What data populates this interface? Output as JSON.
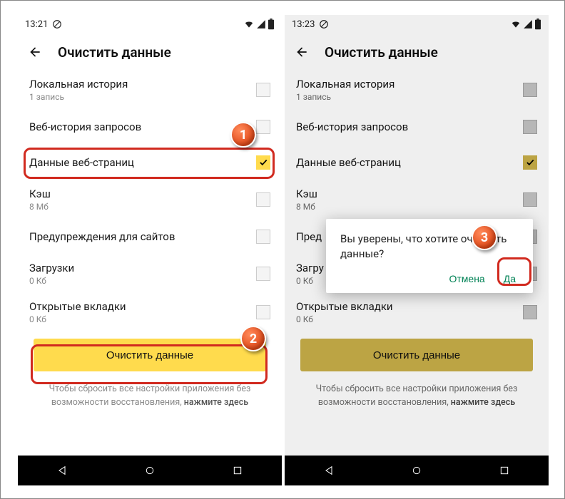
{
  "left": {
    "time": "13:21",
    "title": "Очистить данные",
    "items": [
      {
        "label": "Локальная история",
        "sub": "1 запись",
        "checked": false
      },
      {
        "label": "Веб-история запросов",
        "sub": "",
        "checked": false
      },
      {
        "label": "Данные веб-страниц",
        "sub": "",
        "checked": true
      },
      {
        "label": "Кэш",
        "sub": "8 Мб",
        "checked": false
      },
      {
        "label": "Предупреждения для сайтов",
        "sub": "",
        "checked": false
      },
      {
        "label": "Загрузки",
        "sub": "0 Кб",
        "checked": false
      },
      {
        "label": "Открытые вкладки",
        "sub": "0 Кб",
        "checked": false
      }
    ],
    "clear_btn": "Очистить данные",
    "footnote_a": "Чтобы сбросить все настройки приложения без возможности восстановления, ",
    "footnote_b": "нажмите здесь"
  },
  "right": {
    "time": "13:23",
    "title": "Очистить данные",
    "items": [
      {
        "label": "Локальная история",
        "sub": "1 запись",
        "checked": false
      },
      {
        "label": "Веб-история запросов",
        "sub": "",
        "checked": false
      },
      {
        "label": "Данные веб-страниц",
        "sub": "",
        "checked": true
      },
      {
        "label": "Кэш",
        "sub": "8 Мб",
        "checked": false
      },
      {
        "label": "Пред",
        "sub": "",
        "checked": false
      },
      {
        "label": "Загру",
        "sub": "0 Кб",
        "checked": false
      },
      {
        "label": "Открытые вкладки",
        "sub": "0 Кб",
        "checked": false
      }
    ],
    "clear_btn": "Очистить данные",
    "footnote_a": "Чтобы сбросить все настройки приложения без возможности восстановления, ",
    "footnote_b": "нажмите здесь",
    "dialog": {
      "text": "Вы уверены, что хотите очистить данные?",
      "cancel": "Отмена",
      "ok": "Да"
    }
  },
  "markers": {
    "m1": "1",
    "m2": "2",
    "m3": "3"
  }
}
